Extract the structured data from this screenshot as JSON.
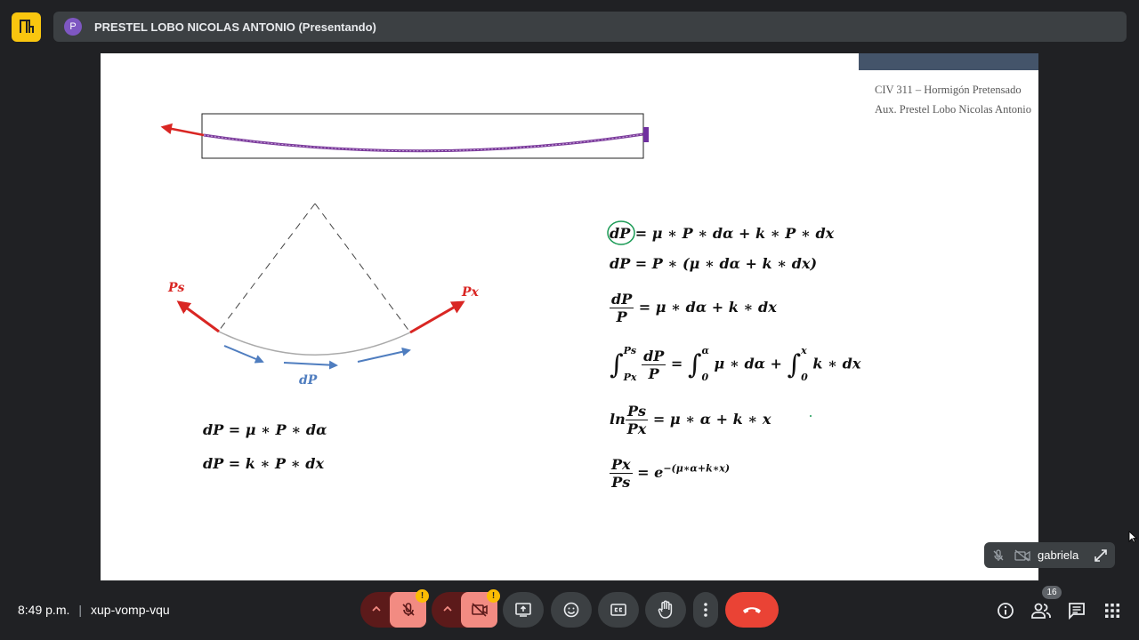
{
  "meeting": {
    "presenter_initial": "P",
    "presenter_label": "PRESTEL LOBO NICOLAS ANTONIO (Presentando)",
    "time": "8:49 p.m.",
    "separator": "|",
    "meeting_code": "xup-vomp-vqu",
    "participant_count": "16",
    "self_tile_name": "gabriela",
    "warning_mark": "!"
  },
  "slide": {
    "course_line1": "CIV 311 – Hormigón Pretensado",
    "course_line2": "Aux. Prestel Lobo Nicolas Antonio",
    "label_ps": "Ps",
    "label_px": "Px",
    "label_dp": "dP",
    "left_eq1": "dP = μ ∗ P ∗ dα",
    "left_eq2": "dP = k ∗ P ∗ dx",
    "eq1_circled": "dP",
    "eq1_rest": "= μ ∗ P ∗ dα + k ∗ P ∗ dx",
    "eq2": "dP = P ∗ (μ ∗ dα + k ∗ dx)",
    "eq3_num": "dP",
    "eq3_den": "P",
    "eq3_rest": "= μ ∗ dα + k ∗ dx",
    "eq4_upper1": "Ps",
    "eq4_lower1": "Px",
    "eq4_num": "dP",
    "eq4_den": "P",
    "eq4_mid": "=",
    "eq4_upper2": "α",
    "eq4_lower2": "0",
    "eq4_term1": "μ ∗ dα +",
    "eq4_upper3": "x",
    "eq4_lower3": "0",
    "eq4_term2": "k ∗ dx",
    "eq5_ln": "ln",
    "eq5_num": "Ps",
    "eq5_den": "Px",
    "eq5_rest": "= μ ∗ α + k ∗ x",
    "eq6_num": "Px",
    "eq6_den": "Ps",
    "eq6_base": "= e",
    "eq6_exp": "−(μ∗α+k∗x)"
  },
  "colors": {
    "background": "#202124",
    "slide_header": "#44546a",
    "force_arrow": "#d92623",
    "dp_arrow": "#4f7dbf",
    "tendon": "#7a3a9a",
    "end_call": "#ea4335",
    "muted_button": "#f28b82",
    "circle_highlight": "#1a9a55"
  },
  "icons": {
    "logo": "meet-logo-icon",
    "mic_off": "mic-off-icon",
    "cam_off": "camera-off-icon",
    "present": "present-screen-icon",
    "emoji": "emoji-icon",
    "captions": "captions-icon",
    "raise_hand": "raise-hand-icon",
    "more": "more-options-icon",
    "end_call": "end-call-icon",
    "info": "info-icon",
    "people": "people-icon",
    "chat": "chat-icon",
    "activities": "activities-grid-icon"
  }
}
